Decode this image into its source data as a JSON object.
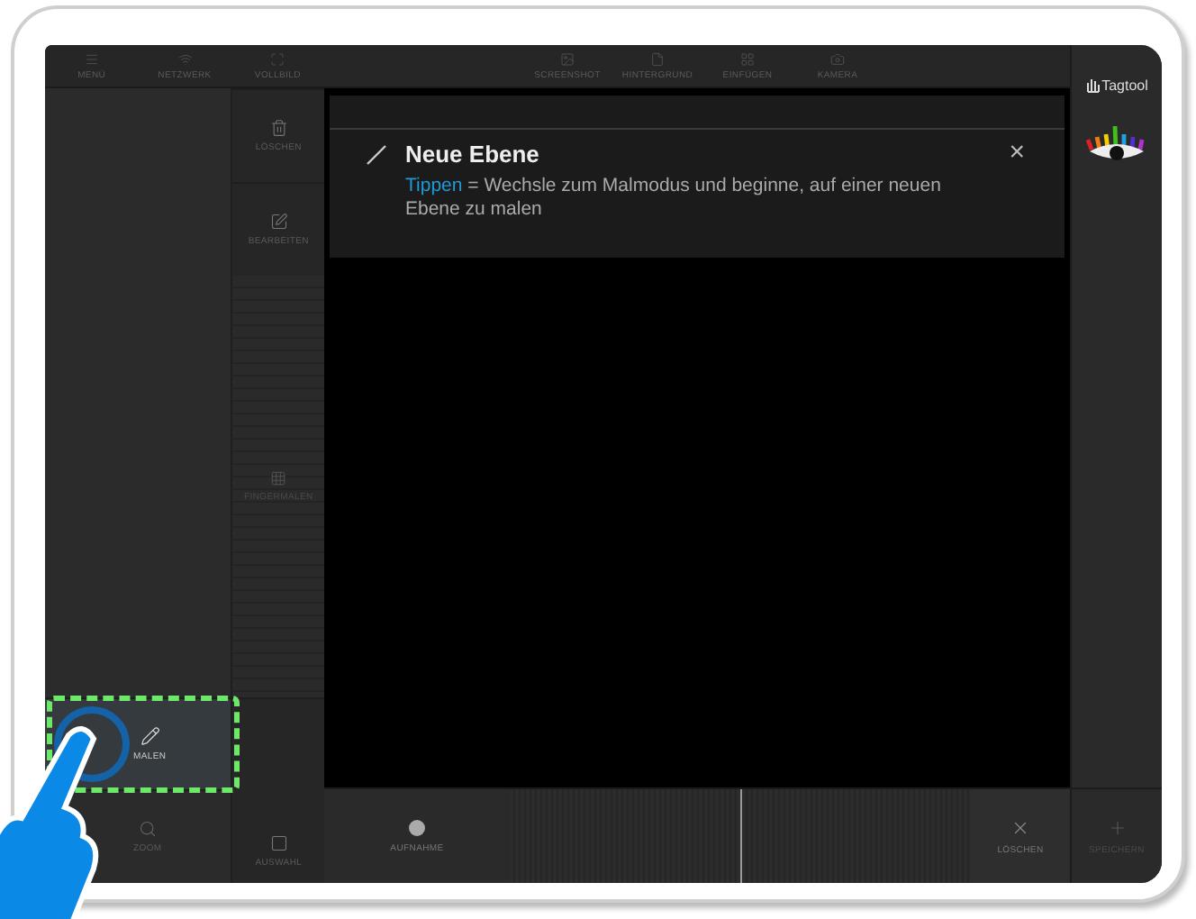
{
  "top_bar": {
    "left": [
      {
        "label": "MENÜ"
      },
      {
        "label": "NETZWERK"
      },
      {
        "label": "VOLLBILD"
      }
    ],
    "center": [
      {
        "label": "SCREENSHOT"
      },
      {
        "label": "HINTERGRUND"
      },
      {
        "label": "EINFÜGEN"
      },
      {
        "label": "KAMERA"
      }
    ]
  },
  "side_tools": [
    {
      "label": "LÖSCHEN"
    },
    {
      "label": "BEARBEITEN"
    }
  ],
  "layer_tool": {
    "label": "FINGERMALEN"
  },
  "brand": {
    "name": "Tagtool"
  },
  "tooltip": {
    "title": "Neue Ebene",
    "highlight": "Tippen",
    "text": "= Wechsle zum Malmodus und beginne, auf einer neuen Ebene zu malen",
    "close": "×"
  },
  "modes": [
    {
      "label": "MALEN",
      "selected": true
    },
    {
      "label": "ZOOM",
      "selected": false
    }
  ],
  "selection_tool": {
    "label": "AUSWAHL"
  },
  "bottom_bar": {
    "record": {
      "label": "AUFNAHME"
    },
    "timeline": {
      "level": 0.5
    },
    "delete": {
      "label": "LÖSCHEN"
    },
    "save": {
      "label": "SPEICHERN"
    }
  }
}
